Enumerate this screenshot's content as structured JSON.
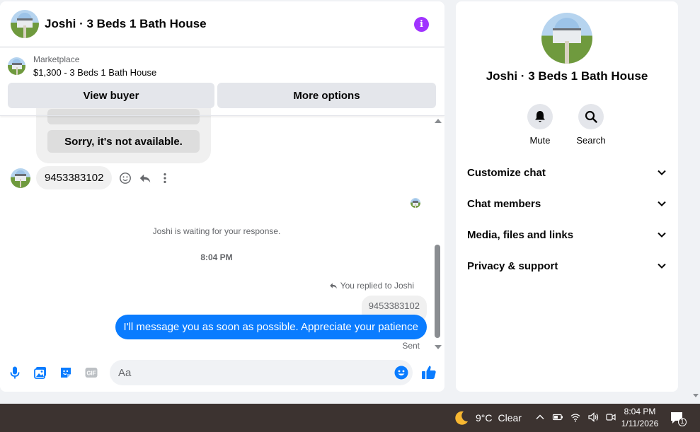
{
  "header": {
    "title": "Joshi · 3 Beds 1 Bath House"
  },
  "marketplace": {
    "label": "Marketplace",
    "listing": "$1,300 - 3 Beds 1 Bath House"
  },
  "actions": {
    "view_buyer": "View buyer",
    "more_options": "More options"
  },
  "quick_replies": {
    "item": "Sorry, it's not available."
  },
  "messages": {
    "incoming": "9453383102",
    "waiting": "Joshi is waiting for your response.",
    "time": "8:04 PM",
    "replied_label": "You replied to Joshi",
    "quoted": "9453383102",
    "outgoing": "I'll message you as soon as possible. Appreciate your patience",
    "status": "Sent"
  },
  "composer": {
    "placeholder": "Aa"
  },
  "panel": {
    "name": "Joshi · 3 Beds 1 Bath House",
    "mute": "Mute",
    "search": "Search",
    "sections": [
      "Customize chat",
      "Chat members",
      "Media, files and links",
      "Privacy & support"
    ]
  },
  "taskbar": {
    "temperature": "9°C",
    "condition": "Clear",
    "time": "8:04 PM",
    "date": "1/11/2026",
    "notification_count": "1"
  },
  "colors": {
    "accent": "#0a7cff",
    "info": "#a033ff"
  }
}
